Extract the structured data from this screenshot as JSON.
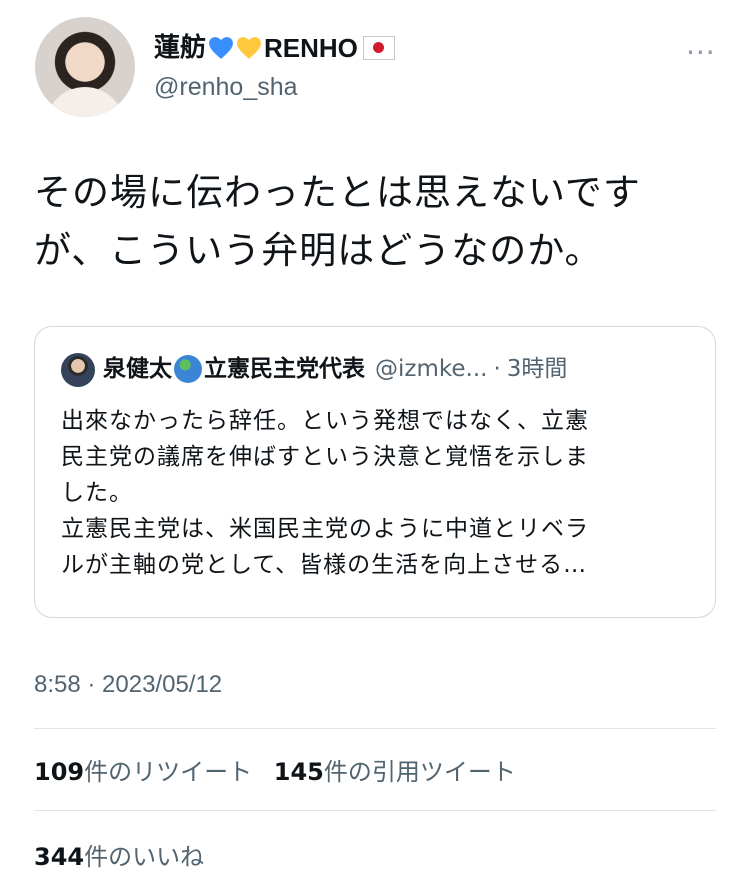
{
  "author": {
    "name": "蓮舫",
    "name_suffix": "RENHO",
    "handle": "@renho_sha",
    "emoji_icons": [
      "blue-heart-icon",
      "yellow-heart-icon",
      "japan-flag-icon"
    ]
  },
  "tweet": {
    "line1": "その場に伝わったとは思えないです",
    "line2": "が、こういう弁明はどうなのか。"
  },
  "quote": {
    "name": "泉健太",
    "name_suffix": "立憲民主党代表",
    "handle": "@izmke...",
    "time": "3時間",
    "lines": [
      "出來なかったら辞任。という発想ではなく、立憲",
      "民主党の議席を伸ばすという決意と覚悟を示しま",
      "した。",
      "立憲民主党は、米国民主党のように中道とリベラ",
      "ルが主軸の党として、皆様の生活を向上させる…"
    ]
  },
  "timestamp": "8:58 · 2023/05/12",
  "stats": {
    "retweets": "109",
    "retweets_label": "件のリツイート",
    "quotes": "145",
    "quotes_label": "件の引用ツイート",
    "likes": "344",
    "likes_label": "件のいいね"
  },
  "colors": {
    "secondary_text": "#536471",
    "border": "#cfd9de",
    "divider": "#dfe5e9"
  }
}
